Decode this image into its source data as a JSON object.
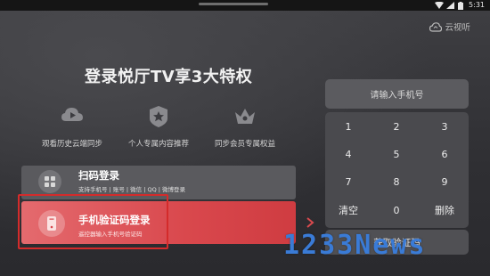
{
  "status_bar": {
    "time": "5:31"
  },
  "brand": {
    "name": "云视听",
    "icon": "cloud-icon"
  },
  "title": "登录悦厅TV享3大特权",
  "features": [
    {
      "icon": "play-icon",
      "label": "观看历史云端同步"
    },
    {
      "icon": "star-badge-icon",
      "label": "个人专属内容推荐"
    },
    {
      "icon": "crown-icon",
      "label": "同步会员专属权益"
    }
  ],
  "login_options": {
    "qr": {
      "title": "扫码登录",
      "subtitle": "支持手机号 | 账号 | 微信 | QQ | 微博登录",
      "icon": "grid-icon"
    },
    "sms": {
      "title": "手机验证码登录",
      "subtitle": "遥控器输入手机号验证码",
      "icon": "phone-icon"
    }
  },
  "keypad": {
    "placeholder": "请输入手机号",
    "keys": [
      "1",
      "2",
      "3",
      "4",
      "5",
      "6",
      "7",
      "8",
      "9",
      "清空",
      "0",
      "删除"
    ],
    "get_code": "获取验证码"
  },
  "watermark": "1233News",
  "colors": {
    "accent": "#d9484d",
    "focus_border": "#d42b2b",
    "watermark": "#3a7bd6"
  }
}
